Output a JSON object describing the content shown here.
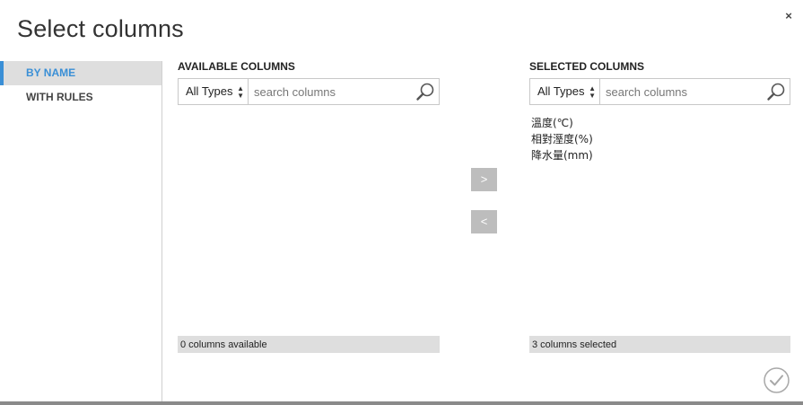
{
  "dialog": {
    "title": "Select columns",
    "close_label": "×"
  },
  "sidebar": {
    "items": [
      {
        "label": "BY NAME",
        "active": true
      },
      {
        "label": "WITH RULES",
        "active": false
      }
    ],
    "accent_color": "#3a8fd6"
  },
  "available": {
    "header": "AVAILABLE COLUMNS",
    "type_filter": "All Types",
    "search_placeholder": "search columns",
    "status": "0 columns available"
  },
  "transfer": {
    "add_label": ">",
    "remove_label": "<"
  },
  "selected": {
    "header": "SELECTED COLUMNS",
    "type_filter": "All Types",
    "search_placeholder": "search columns",
    "columns": [
      "溫度(℃)",
      "相對溼度(%)",
      "降水量(mm)"
    ],
    "status": "3 columns selected"
  },
  "icons": {
    "close": "close-icon",
    "search": "search-icon",
    "select_arrows": "select-arrows-icon",
    "confirm": "checkmark-icon"
  }
}
